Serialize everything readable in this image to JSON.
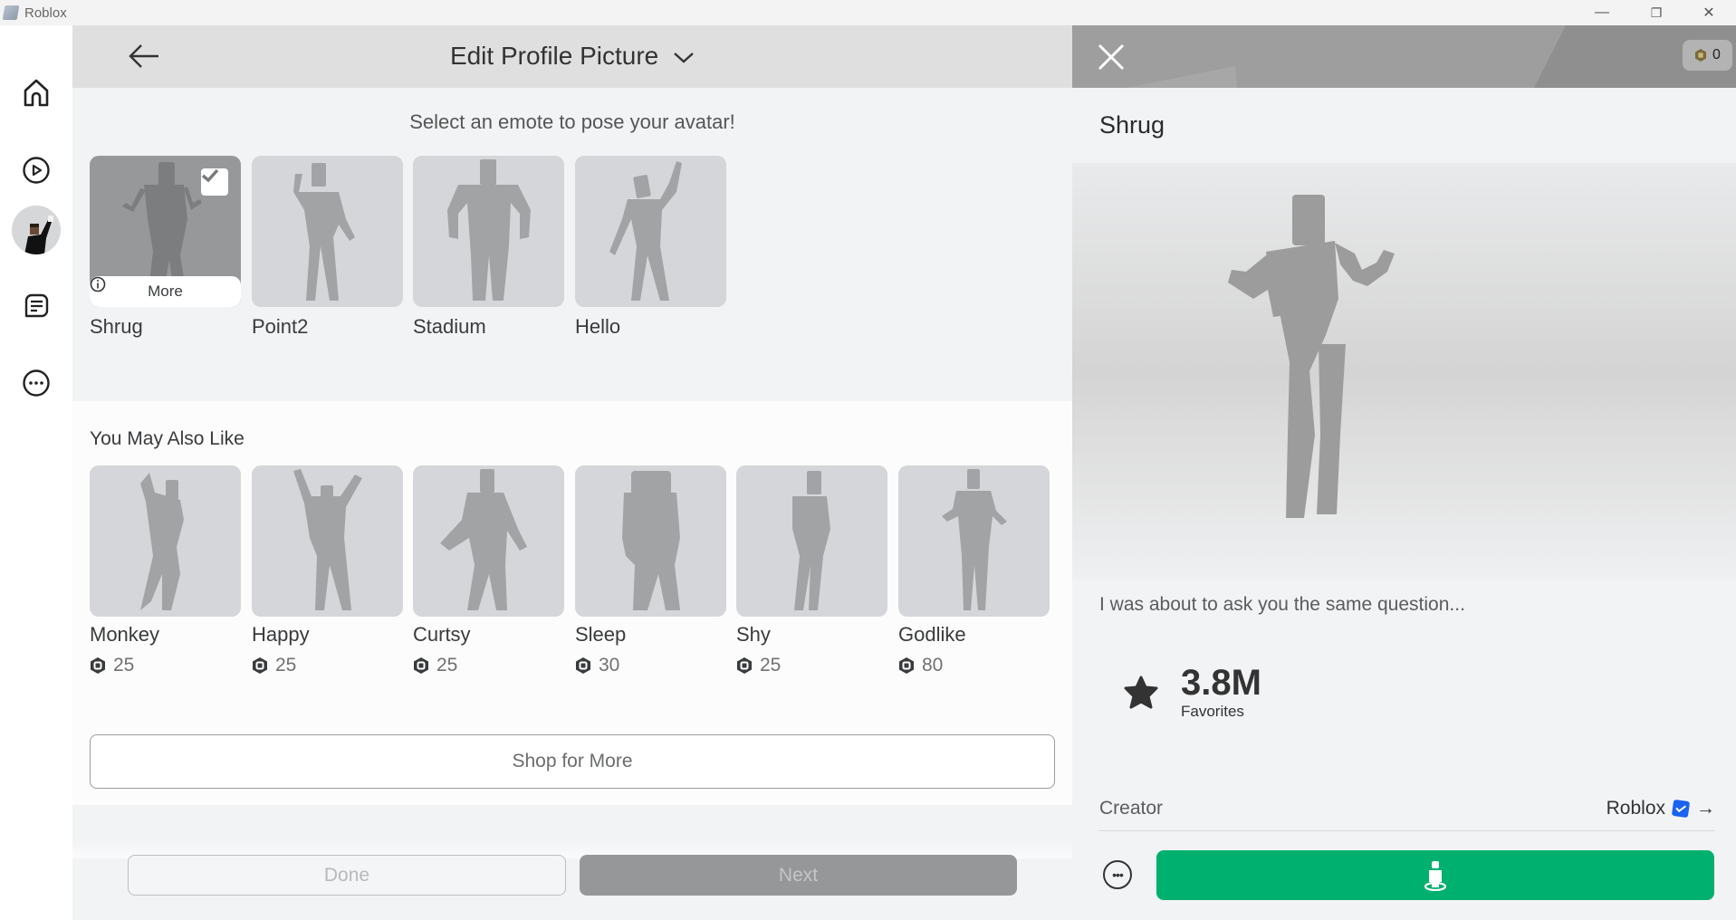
{
  "window": {
    "title": "Roblox",
    "controls": {
      "minimize": "—",
      "restore": "❐",
      "close": "✕"
    }
  },
  "sidebar": {
    "items": [
      {
        "name": "home",
        "icon": "home-icon"
      },
      {
        "name": "play",
        "icon": "play-circle-icon"
      },
      {
        "name": "avatar",
        "icon": "avatar-icon"
      },
      {
        "name": "chat",
        "icon": "chat-icon"
      },
      {
        "name": "more",
        "icon": "more-icon"
      }
    ]
  },
  "editor": {
    "title": "Edit Profile Picture",
    "subtitle": "Select an emote to pose your avatar!",
    "emotes": [
      {
        "name": "Shrug",
        "selected": true,
        "more_label": "More"
      },
      {
        "name": "Point2",
        "selected": false
      },
      {
        "name": "Stadium",
        "selected": false
      },
      {
        "name": "Hello",
        "selected": false
      }
    ],
    "recommendations": {
      "title": "You May Also Like",
      "items": [
        {
          "name": "Monkey",
          "price": "25"
        },
        {
          "name": "Happy",
          "price": "25"
        },
        {
          "name": "Curtsy",
          "price": "25"
        },
        {
          "name": "Sleep",
          "price": "30"
        },
        {
          "name": "Shy",
          "price": "25"
        },
        {
          "name": "Godlike",
          "price": "80"
        }
      ],
      "shop_label": "Shop for More"
    },
    "done_label": "Done",
    "next_label": "Next"
  },
  "details": {
    "robux_balance": "0",
    "item_name": "Shrug",
    "description": "I was about to ask you the same question...",
    "favorites_count": "3.8M",
    "favorites_label": "Favorites",
    "creator_label": "Creator",
    "creator_name": "Roblox",
    "creator_arrow": "→",
    "more_options": "•••",
    "colors": {
      "try_on": "#00b06f",
      "verified": "#1a62f0"
    }
  }
}
